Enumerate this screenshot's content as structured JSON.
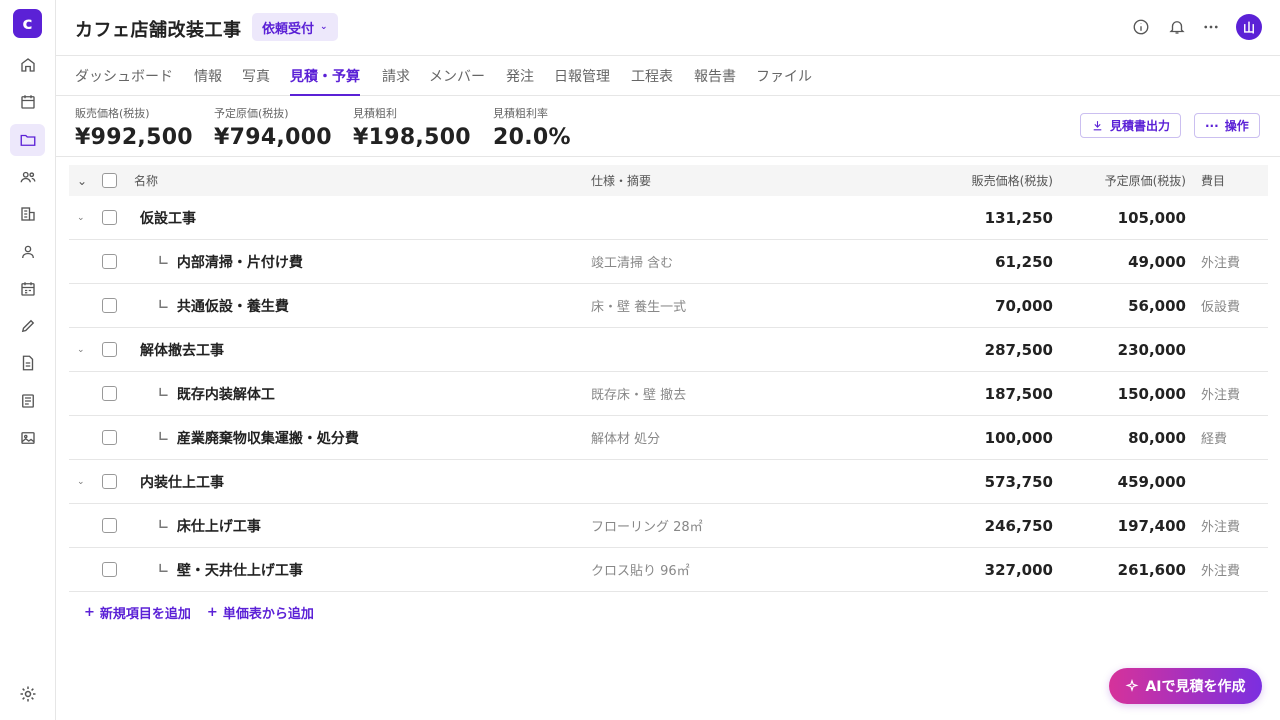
{
  "app": {
    "logo_letter": "c",
    "accent": "#5b21d6"
  },
  "sidebar": {
    "items": [
      {
        "icon": "home-icon"
      },
      {
        "icon": "calendar-icon"
      },
      {
        "icon": "folder-icon",
        "active": true
      },
      {
        "icon": "users-icon"
      },
      {
        "icon": "building-icon"
      },
      {
        "icon": "person-icon"
      },
      {
        "icon": "schedule-icon"
      },
      {
        "icon": "pencil-icon"
      },
      {
        "icon": "document-icon"
      },
      {
        "icon": "list-document-icon"
      },
      {
        "icon": "image-icon"
      }
    ],
    "settings_icon": "gear-icon"
  },
  "header": {
    "title": "カフェ店舗改装工事",
    "status": "依頼受付",
    "avatar": "山"
  },
  "tabs": [
    "ダッシュボード",
    "情報",
    "写真",
    "見積・予算",
    "請求",
    "メンバー",
    "発注",
    "日報管理",
    "工程表",
    "報告書",
    "ファイル"
  ],
  "active_tab": "見積・予算",
  "summary": {
    "items": [
      {
        "label": "販売価格(税抜)",
        "value": "¥992,500"
      },
      {
        "label": "予定原価(税抜)",
        "value": "¥794,000"
      },
      {
        "label": "見積粗利",
        "value": "¥198,500"
      },
      {
        "label": "見積粗利率",
        "value": "20.0%"
      }
    ],
    "export_button": "見積書出力",
    "actions_button": "操作"
  },
  "table": {
    "headers": {
      "name": "名称",
      "spec": "仕様・摘要",
      "price": "販売価格(税抜)",
      "cost": "予定原価(税抜)",
      "category": "費目"
    },
    "rows": [
      {
        "type": "group",
        "name": "仮設工事",
        "spec": "",
        "price": "131,250",
        "cost": "105,000",
        "category": ""
      },
      {
        "type": "item",
        "name": "内部清掃・片付け費",
        "spec": "竣工清掃 含む",
        "price": "61,250",
        "cost": "49,000",
        "category": "外注費"
      },
      {
        "type": "item",
        "name": "共通仮設・養生費",
        "spec": "床・壁 養生一式",
        "price": "70,000",
        "cost": "56,000",
        "category": "仮設費"
      },
      {
        "type": "group",
        "name": "解体撤去工事",
        "spec": "",
        "price": "287,500",
        "cost": "230,000",
        "category": ""
      },
      {
        "type": "item",
        "name": "既存内装解体工",
        "spec": "既存床・壁 撤去",
        "price": "187,500",
        "cost": "150,000",
        "category": "外注費"
      },
      {
        "type": "item",
        "name": "産業廃棄物収集運搬・処分費",
        "spec": "解体材 処分",
        "price": "100,000",
        "cost": "80,000",
        "category": "経費"
      },
      {
        "type": "group",
        "name": "内装仕上工事",
        "spec": "",
        "price": "573,750",
        "cost": "459,000",
        "category": ""
      },
      {
        "type": "item",
        "name": "床仕上げ工事",
        "spec": "フローリング 28㎡",
        "price": "246,750",
        "cost": "197,400",
        "category": "外注費"
      },
      {
        "type": "item",
        "name": "壁・天井仕上げ工事",
        "spec": "クロス貼り 96㎡",
        "price": "327,000",
        "cost": "261,600",
        "category": "外注費"
      }
    ]
  },
  "add": {
    "new_item": "新規項目を追加",
    "from_price_list": "単価表から追加"
  },
  "ai_button": "AIで見積を作成"
}
